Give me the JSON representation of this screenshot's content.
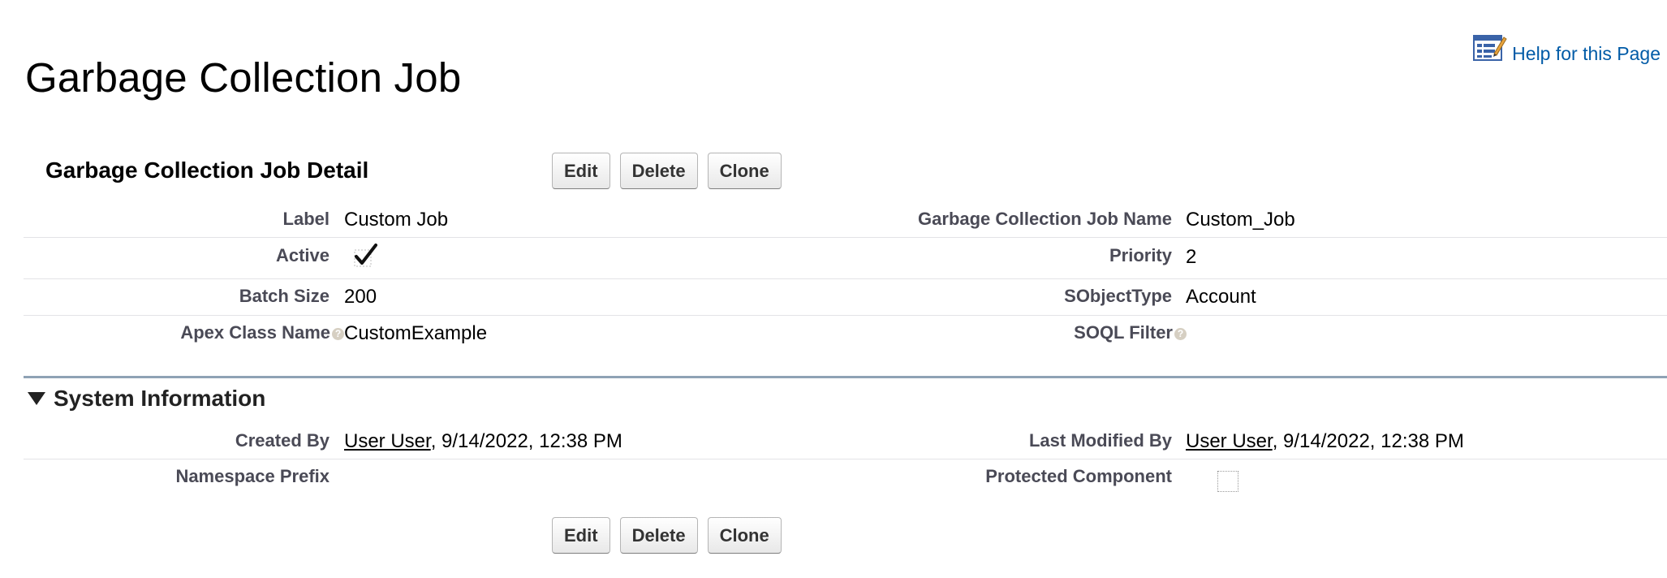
{
  "page": {
    "title": "Garbage Collection Job",
    "help_link": "Help for this Page",
    "help_icon": "help-page-icon"
  },
  "detail": {
    "section_title": "Garbage Collection Job Detail",
    "buttons": {
      "edit": "Edit",
      "delete": "Delete",
      "clone": "Clone"
    },
    "fields": {
      "label": {
        "label": "Label",
        "value": "Custom Job"
      },
      "job_name": {
        "label": "Garbage Collection Job Name",
        "value": "Custom_Job"
      },
      "active": {
        "label": "Active",
        "checked": true
      },
      "priority": {
        "label": "Priority",
        "value": "2"
      },
      "batch_size": {
        "label": "Batch Size",
        "value": "200"
      },
      "sobject_type": {
        "label": "SObjectType",
        "value": "Account"
      },
      "apex_class": {
        "label": "Apex Class Name",
        "value": "CustomExample"
      },
      "soql_filter": {
        "label": "SOQL Filter",
        "value": ""
      }
    }
  },
  "system_info": {
    "title": "System Information",
    "fields": {
      "created_by": {
        "label": "Created By",
        "user": "User User",
        "date": ", 9/14/2022, 12:38 PM"
      },
      "last_modified_by": {
        "label": "Last Modified By",
        "user": "User User",
        "date": ", 9/14/2022, 12:38 PM"
      },
      "namespace_prefix": {
        "label": "Namespace Prefix",
        "value": ""
      },
      "protected_component": {
        "label": "Protected Component",
        "checked": false
      }
    }
  },
  "bottom_buttons": {
    "edit": "Edit",
    "delete": "Delete",
    "clone": "Clone"
  },
  "colors": {
    "link": "#015ba7",
    "label": "#4a4a56",
    "divider": "#8fa2b5"
  }
}
